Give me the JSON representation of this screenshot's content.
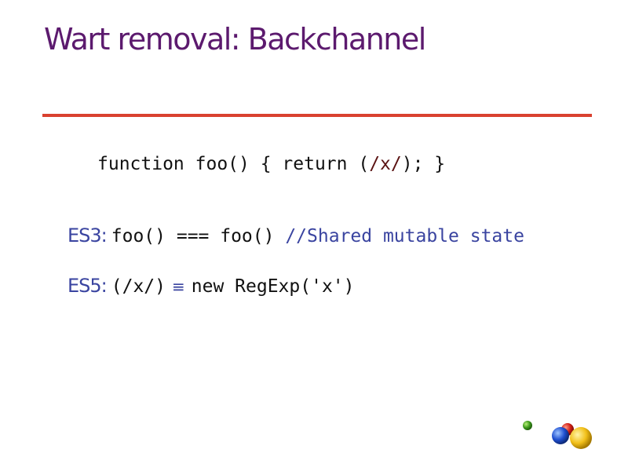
{
  "slide": {
    "title": "Wart removal: Backchannel",
    "code_line": {
      "pre": "function foo() { return (",
      "regex": "/x/",
      "post": "); }"
    },
    "es3": {
      "label": "ES3:",
      "code": "foo() === foo() ",
      "comment": "//Shared mutable state"
    },
    "es5": {
      "label": "ES5:",
      "lhs": "(/x/)",
      "equiv": "≡",
      "rhs": "new RegExp('x')"
    }
  },
  "colors": {
    "title": "#5c1a6e",
    "rule": "#d9412f",
    "es_label": "#3a44a0",
    "regex": "#5a1212"
  },
  "logo": {
    "icon": "google-balls-logo"
  }
}
